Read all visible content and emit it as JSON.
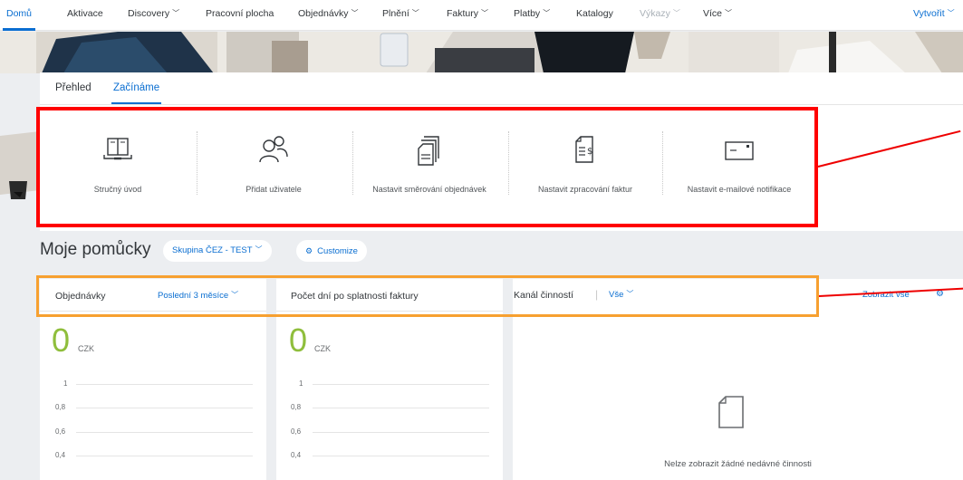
{
  "nav": {
    "items": [
      {
        "label": "Domů",
        "dropdown": false,
        "state": "active"
      },
      {
        "label": "Aktivace",
        "dropdown": false,
        "state": "normal"
      },
      {
        "label": "Discovery",
        "dropdown": true,
        "state": "normal"
      },
      {
        "label": "Pracovní plocha",
        "dropdown": false,
        "state": "normal"
      },
      {
        "label": "Objednávky",
        "dropdown": true,
        "state": "normal"
      },
      {
        "label": "Plnění",
        "dropdown": true,
        "state": "normal"
      },
      {
        "label": "Faktury",
        "dropdown": true,
        "state": "normal"
      },
      {
        "label": "Platby",
        "dropdown": true,
        "state": "normal"
      },
      {
        "label": "Katalogy",
        "dropdown": false,
        "state": "normal"
      },
      {
        "label": "Výkazy",
        "dropdown": true,
        "state": "disabled"
      },
      {
        "label": "Více",
        "dropdown": true,
        "state": "normal"
      }
    ],
    "create_label": "Vytvořit"
  },
  "tabs": {
    "overview": "Přehled",
    "getting_started": "Začínáme"
  },
  "tiles": [
    {
      "label": "Stručný úvod",
      "icon": "book-icon"
    },
    {
      "label": "Přidat uživatele",
      "icon": "users-icon"
    },
    {
      "label": "Nastavit směrování objednávek",
      "icon": "documents-icon"
    },
    {
      "label": "Nastavit zpracování faktur",
      "icon": "invoice-icon"
    },
    {
      "label": "Nastavit e-mailové notifikace",
      "icon": "envelope-icon"
    }
  ],
  "tools": {
    "title": "Moje pomůcky",
    "group_label": "Skupina ČEZ - TEST",
    "customize_label": "Customize"
  },
  "widgets": {
    "orders": {
      "title": "Objednávky",
      "period": "Poslední 3 měsíce",
      "value": "0",
      "currency": "CZK",
      "ticks": [
        "1",
        "0,8",
        "0,6",
        "0,4"
      ]
    },
    "invoice_days": {
      "title": "Počet dní po splatnosti faktury",
      "value": "0",
      "currency": "CZK",
      "ticks": [
        "1",
        "0,8",
        "0,6",
        "0,4"
      ]
    },
    "activity": {
      "title": "Kanál činností",
      "filter": "Vše",
      "view_all": "Zobrazit vše",
      "empty_message": "Nelze zobrazit žádné nedávné činnosti"
    }
  },
  "colors": {
    "accent": "#0a6ed1",
    "value_green": "#8fbe3c",
    "highlight_red": "#ff0000",
    "highlight_orange": "#f7a030"
  }
}
